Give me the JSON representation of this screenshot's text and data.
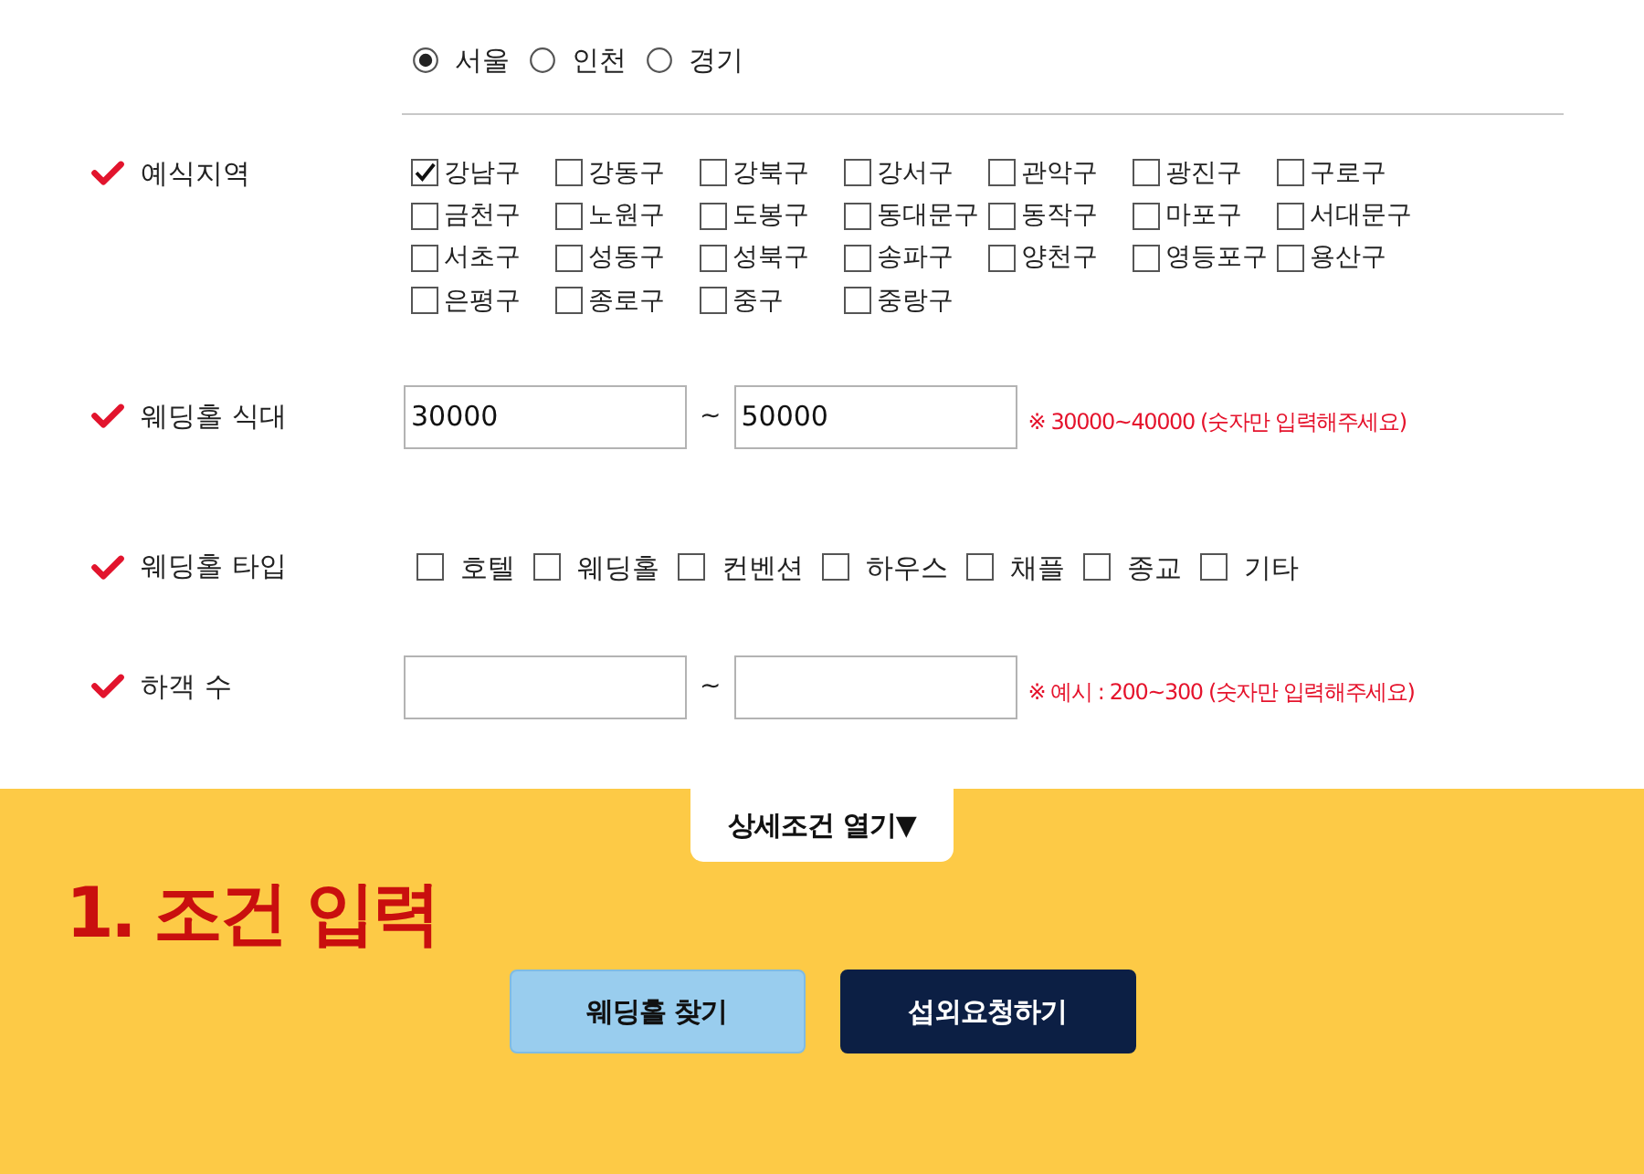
{
  "city_options": [
    {
      "label": "서울",
      "selected": true
    },
    {
      "label": "인천",
      "selected": false
    },
    {
      "label": "경기",
      "selected": false
    }
  ],
  "fields": [
    {
      "kind": "checkbox_grid",
      "label": "예식지역",
      "options": [
        {
          "label": "강남구",
          "checked": true
        },
        {
          "label": "강동구",
          "checked": false
        },
        {
          "label": "강북구",
          "checked": false
        },
        {
          "label": "강서구",
          "checked": false
        },
        {
          "label": "관악구",
          "checked": false
        },
        {
          "label": "광진구",
          "checked": false
        },
        {
          "label": "구로구",
          "checked": false
        },
        {
          "label": "금천구",
          "checked": false
        },
        {
          "label": "노원구",
          "checked": false
        },
        {
          "label": "도봉구",
          "checked": false
        },
        {
          "label": "동대문구",
          "checked": false
        },
        {
          "label": "동작구",
          "checked": false
        },
        {
          "label": "마포구",
          "checked": false
        },
        {
          "label": "서대문구",
          "checked": false
        },
        {
          "label": "서초구",
          "checked": false
        },
        {
          "label": "성동구",
          "checked": false
        },
        {
          "label": "성북구",
          "checked": false
        },
        {
          "label": "송파구",
          "checked": false
        },
        {
          "label": "양천구",
          "checked": false
        },
        {
          "label": "영등포구",
          "checked": false
        },
        {
          "label": "용산구",
          "checked": false
        },
        {
          "label": "은평구",
          "checked": false
        },
        {
          "label": "종로구",
          "checked": false
        },
        {
          "label": "중구",
          "checked": false
        },
        {
          "label": "중랑구",
          "checked": false
        }
      ]
    },
    {
      "kind": "range",
      "label": "웨딩홀 식대",
      "from_value": "30000",
      "separator": "~",
      "to_value": "50000",
      "note": "※ 30000~40000 (숫자만 입력해주세요)"
    },
    {
      "kind": "checkbox_row",
      "label": "웨딩홀 타입",
      "options": [
        {
          "label": "호텔",
          "checked": false
        },
        {
          "label": "웨딩홀",
          "checked": false
        },
        {
          "label": "컨벤션",
          "checked": false
        },
        {
          "label": "하우스",
          "checked": false
        },
        {
          "label": "채플",
          "checked": false
        },
        {
          "label": "종교",
          "checked": false
        },
        {
          "label": "기타",
          "checked": false
        }
      ]
    },
    {
      "kind": "range",
      "label": "하객 수",
      "separator": "~",
      "note": "※ 예시 : 200~300 (숫자만 입력해주세요)"
    }
  ],
  "detail_toggle": {
    "label": "상세조건 열기▼"
  },
  "section_title": "1. 조건 입력",
  "buttons": [
    {
      "label": "웨딩홀 찾기",
      "kind": "secondary"
    },
    {
      "label": "섭외요청하기",
      "kind": "primary"
    }
  ]
}
